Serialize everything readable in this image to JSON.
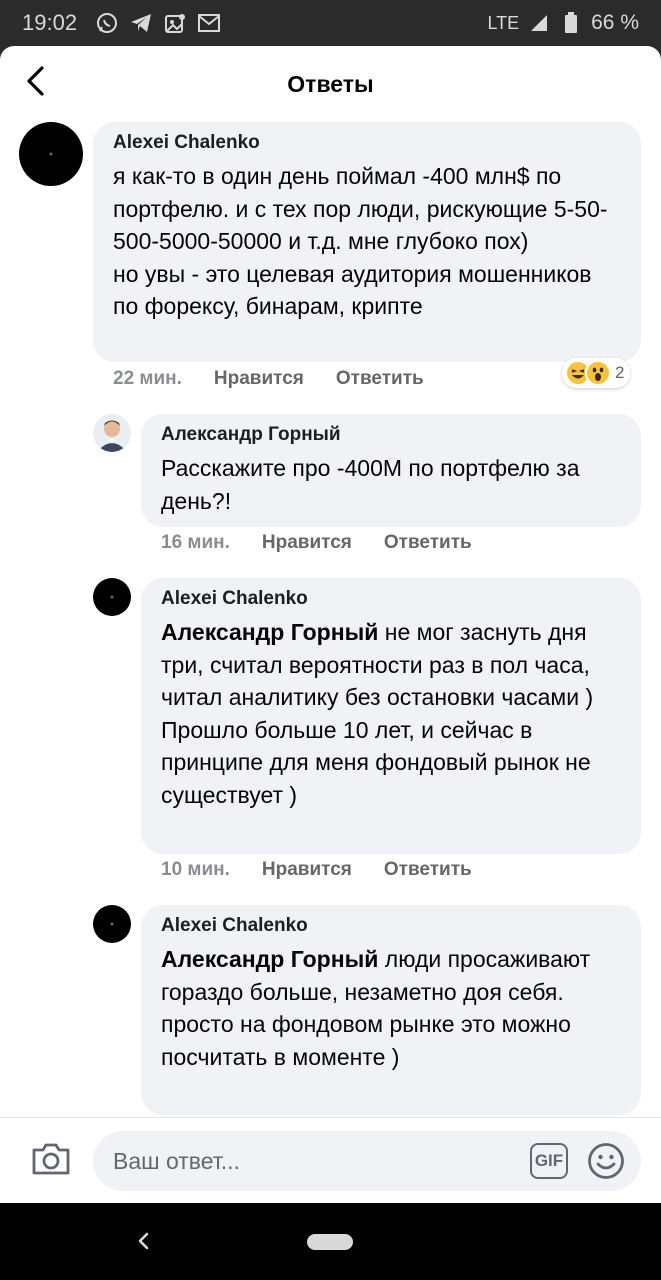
{
  "status_bar": {
    "time": "19:02",
    "network": "LTE",
    "battery": "66 %"
  },
  "header": {
    "title": "Ответы"
  },
  "comments": [
    {
      "author": "Alexei Chalenko",
      "mention": "",
      "text": "я как-то в один день поймал -400 млн$ по портфелю. и с тех пор люди, рискующие 5-50-500-5000-50000 и т.д. мне глубоко пох)\nно увы - это целевая аудитория мошенников по форексу, бинарам, крипте",
      "time": "22 мин.",
      "like_label": "Нравится",
      "reply_label": "Ответить",
      "reaction_count": "2"
    },
    {
      "author": "Александр Горный",
      "mention": "",
      "text": "Расскажите про -400М по портфелю за день?!",
      "time": "16 мин.",
      "like_label": "Нравится",
      "reply_label": "Ответить"
    },
    {
      "author": "Alexei Chalenko",
      "mention": "Александр Горный",
      "text": " не мог заснуть дня три, считал вероятности раз в пол часа, читал аналитику без остановки часами )\nПрошло больше 10 лет, и сейчас в принципе для меня фондовый рынок не существует )",
      "time": "10 мин.",
      "like_label": "Нравится",
      "reply_label": "Ответить"
    },
    {
      "author": "Alexei Chalenko",
      "mention": "Александр Горный",
      "text": " люди просаживают гораздо больше, незаметно доя себя. просто на фондовом рынке это можно посчитать в моменте )"
    }
  ],
  "composer": {
    "placeholder": "Ваш ответ...",
    "gif_label": "GIF"
  },
  "colors": {
    "bubble": "#f0f2f5",
    "meta_text": "#65676b",
    "reaction_emoji": "#f7c33a"
  }
}
